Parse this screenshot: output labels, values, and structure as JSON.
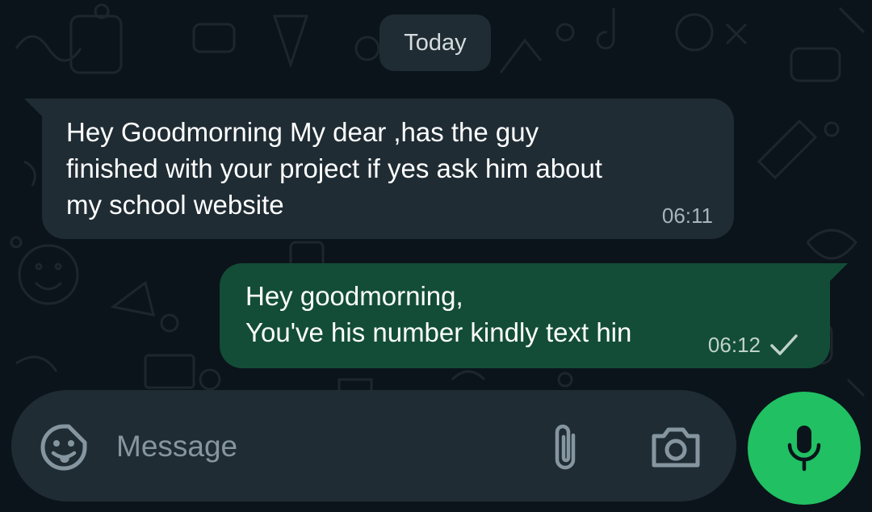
{
  "chat": {
    "date_label": "Today",
    "messages": [
      {
        "direction": "incoming",
        "lines": [
          "Hey Goodmorning My dear ,has the guy",
          "finished with your project if yes ask him about",
          "my school website"
        ],
        "time": "06:11"
      },
      {
        "direction": "outgoing",
        "lines": [
          "Hey goodmorning,",
          "You've his number kindly text hin"
        ],
        "time": "06:12",
        "status_icon": "single-check-icon"
      }
    ]
  },
  "composer": {
    "placeholder": "Message",
    "value": "",
    "icons": {
      "emoji": "sticker-emoji-icon",
      "attach": "paperclip-icon",
      "camera": "camera-icon",
      "send": "microphone-icon"
    }
  },
  "colors": {
    "background": "#0b141a",
    "incoming_bubble": "#1f2c34",
    "outgoing_bubble": "#134d37",
    "mic_button": "#21c063"
  }
}
